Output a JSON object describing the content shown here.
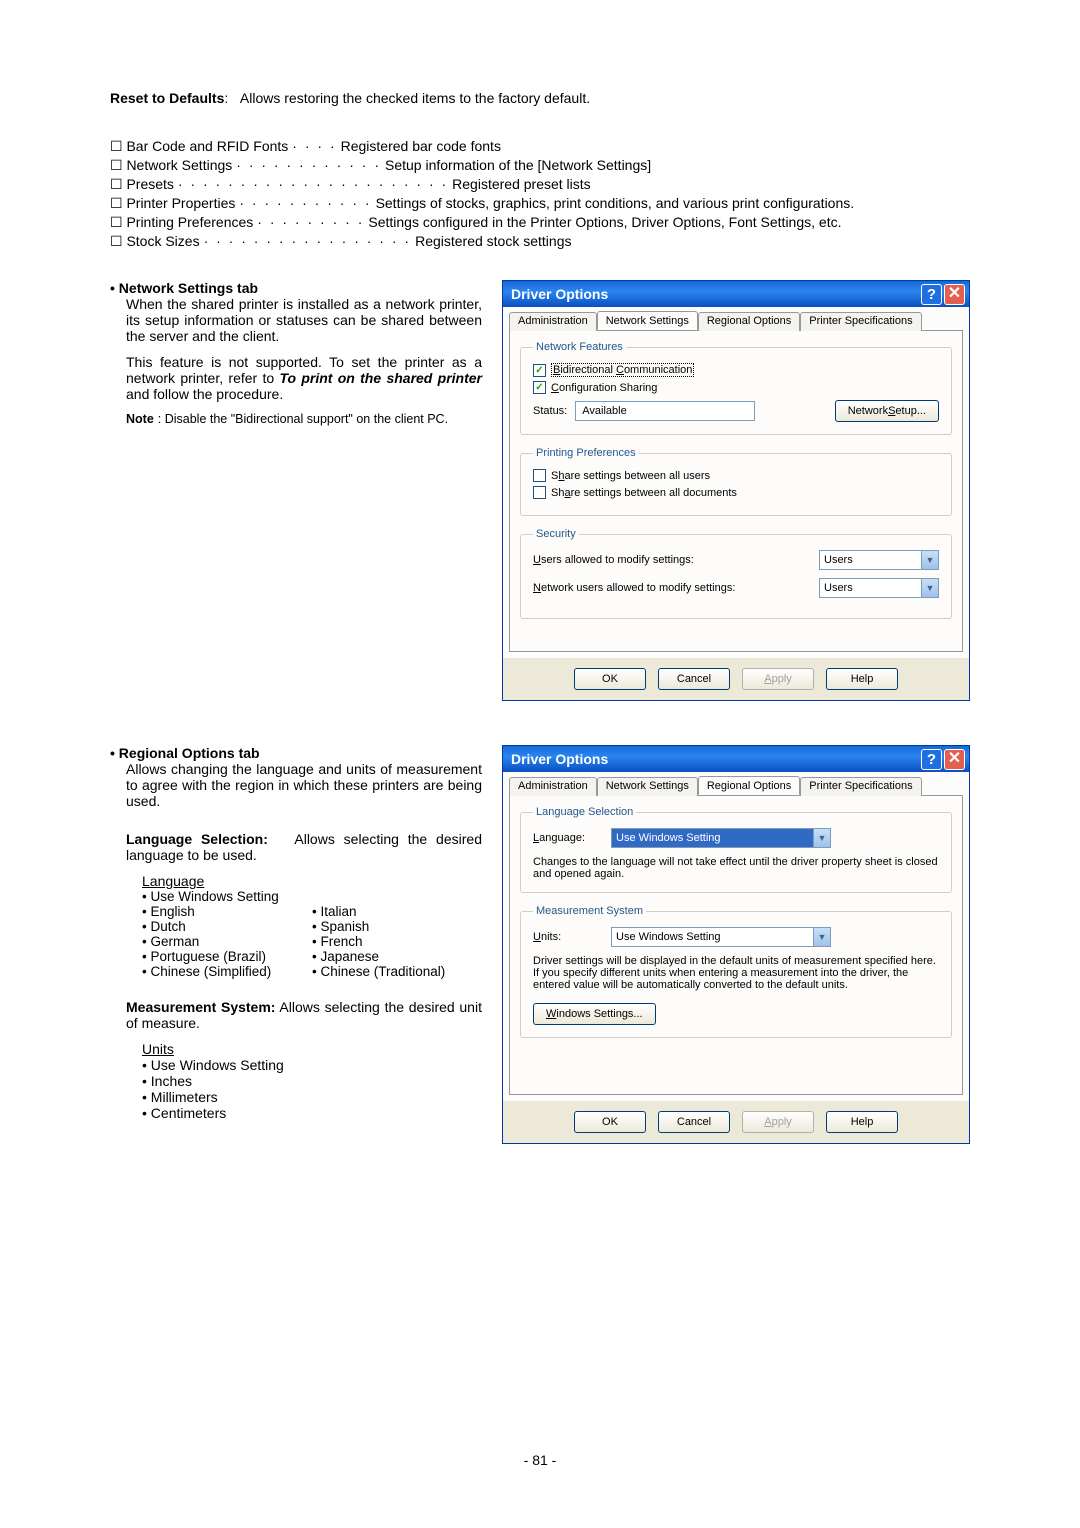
{
  "reset_heading": "Reset to Defaults",
  "reset_colon": ":",
  "reset_desc": "Allows restoring the checked items to the factory default.",
  "defns": [
    {
      "term": "☐ Bar Code and RFID Fonts",
      "dots": "· · · ·",
      "desc": "Registered bar code fonts"
    },
    {
      "term": "☐ Network Settings",
      "dots": "· · · · · · · · · · · ·",
      "desc": "Setup information of the [Network Settings]"
    },
    {
      "term": "☐ Presets",
      "dots": "· · · · · · · · · · · · · · · · · · · · · ·",
      "desc": "Registered preset lists"
    },
    {
      "term": "☐ Printer Properties",
      "dots": "· · · · · · · · · · ·",
      "desc": "Settings of stocks, graphics, print conditions, and various print configurations."
    },
    {
      "term": "☐ Printing Preferences",
      "dots": "· · · · · · · · ·",
      "desc": "Settings configured in the Printer Options, Driver Options, Font Settings, etc."
    },
    {
      "term": "☐ Stock Sizes",
      "dots": "· · · · · · · · · · · · · · · · ·",
      "desc": "Registered stock settings"
    }
  ],
  "net_tab_heading": "• Network Settings tab",
  "net_para1": "When the shared printer is installed as a network printer, its setup information or statuses can be shared between the server and the client.",
  "net_para2_a": "This feature is not supported.   To set the printer as a network printer, refer to ",
  "net_para2_b": "To print on the shared printer",
  "net_para2_c": " and follow the procedure.",
  "net_note_label": "Note",
  "net_note_body": ": Disable the \"Bidirectional support\" on the client PC.",
  "reg_tab_heading": "• Regional Options tab",
  "reg_para1": "Allows changing the language and units of measurement to agree with the region in which these printers are being used.",
  "lang_sel_heading": "Language Selection:",
  "lang_sel_desc": "Allows selecting the desired language to be used.",
  "lang_list_heading": "Language",
  "lang_items": [
    "• Use Windows Setting",
    "",
    "• English",
    "• Italian",
    "• Dutch",
    "• Spanish",
    "• German",
    "• French",
    "• Portuguese (Brazil)",
    "• Japanese",
    "• Chinese (Simplified)",
    "• Chinese (Traditional)"
  ],
  "meas_heading": "Measurement System:",
  "meas_desc": "Allows selecting the desired unit of measure.",
  "units_heading": "Units",
  "units_items": [
    "• Use Windows Setting",
    "• Inches",
    "• Millimeters",
    "• Centimeters"
  ],
  "page_num": "- 81 -",
  "dlg1": {
    "title": "Driver Options",
    "tabs": [
      "Administration",
      "Network Settings",
      "Regional Options",
      "Printer Specifications"
    ],
    "netfeat_legend": "Network Features",
    "chk_bidi_pre": "B",
    "chk_bidi_mid": "idirectional ",
    "chk_bidi_c": "C",
    "chk_bidi_post": "ommunication",
    "chk_cfg_c": "C",
    "chk_cfg_post": "onfiguration Sharing",
    "status_label": "Status:",
    "status_val": "Available",
    "btn_netsetup_pre": "Network ",
    "btn_netsetup_s": "S",
    "btn_netsetup_post": "etup...",
    "pp_legend": "Printing Preferences",
    "pp_chk1_pre": "S",
    "pp_chk1_h": "h",
    "pp_chk1_post": "are settings between all users",
    "pp_chk2_pre": "Sh",
    "pp_chk2_a": "a",
    "pp_chk2_post": "re settings between all documents",
    "sec_legend": "Security",
    "sec1_lbl_u": "U",
    "sec1_lbl_post": "sers allowed to modify settings:",
    "sec1_val": "Users",
    "sec2_lbl_n": "N",
    "sec2_lbl_post": "etwork users allowed to modify settings:",
    "sec2_val": "Users",
    "btn_ok": "OK",
    "btn_cancel": "Cancel",
    "btn_apply_a": "A",
    "btn_apply_post": "pply",
    "btn_help": "Help"
  },
  "dlg2": {
    "title": "Driver Options",
    "tabs": [
      "Administration",
      "Network Settings",
      "Regional Options",
      "Printer Specifications"
    ],
    "ls_legend": "Language Selection",
    "lang_lbl_l": "L",
    "lang_lbl_post": "anguage:",
    "lang_val": "Use Windows Setting",
    "lang_note": "Changes to the language will not take effect until the driver property sheet is closed and opened again.",
    "ms_legend": "Measurement System",
    "units_lbl_u": "U",
    "units_lbl_post": "nits:",
    "units_val": "Use Windows Setting",
    "units_note": "Driver settings will be displayed in the default units of measurement specified here.  If you specify different units when entering a measurement into the driver, the entered value will be automatically converted to the default units.",
    "btn_ws_w": "W",
    "btn_ws_post": "indows Settings...",
    "btn_ok": "OK",
    "btn_cancel": "Cancel",
    "btn_apply_a": "A",
    "btn_apply_post": "pply",
    "btn_help": "Help"
  }
}
